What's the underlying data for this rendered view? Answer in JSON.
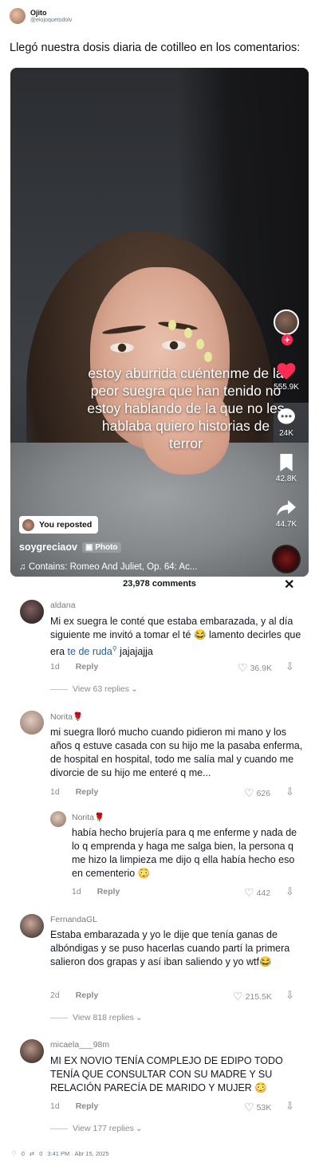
{
  "tweet": {
    "author_name": "Ojito",
    "author_handle": "@elojoquetodolv",
    "text": "Llegó nuestra dosis diaria de cotilleo en los comentarios:",
    "likes": "0",
    "retweets": "0",
    "timestamp": "3:41 PM · Abr 15, 2025"
  },
  "video": {
    "overlay_text": "estoy aburrida cuéntenme de la peor suegra que han tenido no estoy hablando de la que no les hablaba quiero historias de terror",
    "likes": "555.9K",
    "comments": "24K",
    "saves": "42.8K",
    "shares": "44.7K",
    "reposted_label": "You reposted",
    "username": "soygreciaov",
    "photo_label": "Photo",
    "music": "Contains: Romeo And Juliet, Op. 64: Ac..."
  },
  "comments_panel": {
    "count_label": "23,978 comments",
    "comments": [
      {
        "user": "aldana",
        "text_before": "Mi ex suegra le conté que estaba embarazada, y al día siguiente me invitó a tomar el té 😂 lamento decirles que era ",
        "link": "te de ruda",
        "text_after": " jajajajja",
        "age": "1d",
        "reply": "Reply",
        "likes": "36.9K",
        "view_replies": "View 63 replies"
      },
      {
        "user": "Norita🌹",
        "text": "mi suegra lloró mucho cuando pidieron mi mano y los años q estuve casada con su hijo me la pasaba enferma, de hospital en hospital, todo me salía mal y cuando me divorcie de su hijo me enteré q me...",
        "age": "1d",
        "reply": "Reply",
        "likes": "626"
      },
      {
        "user": "Norita🌹",
        "text": "había hecho brujería para q me enferme y nada de lo q emprenda y haga me salga bien, la persona q me hizo la limpieza me dijo q ella había hecho eso en cementerio 😳",
        "age": "1d",
        "reply": "Reply",
        "likes": "442"
      },
      {
        "user": "FernandaGL",
        "text": "Estaba embarazada y yo le dije que tenía ganas de albóndigas y se puso hacerlas cuando partí la primera salieron dos grapas y así iban saliendo y yo wtf😂",
        "age": "2d",
        "reply": "Reply",
        "likes": "215.5K",
        "view_replies": "View 818 replies"
      },
      {
        "user": "micaela___98m",
        "text": "MI EX NOVIO TENÍA COMPLEJO DE EDIPO TODO TENÍA QUE CONSULTAR CON SU MADRE Y SU RELACIÓN PARECÍA DE MARIDO Y MUJER 😳",
        "age": "1d",
        "reply": "Reply",
        "likes": "53K",
        "view_replies": "View 177 replies"
      }
    ]
  }
}
